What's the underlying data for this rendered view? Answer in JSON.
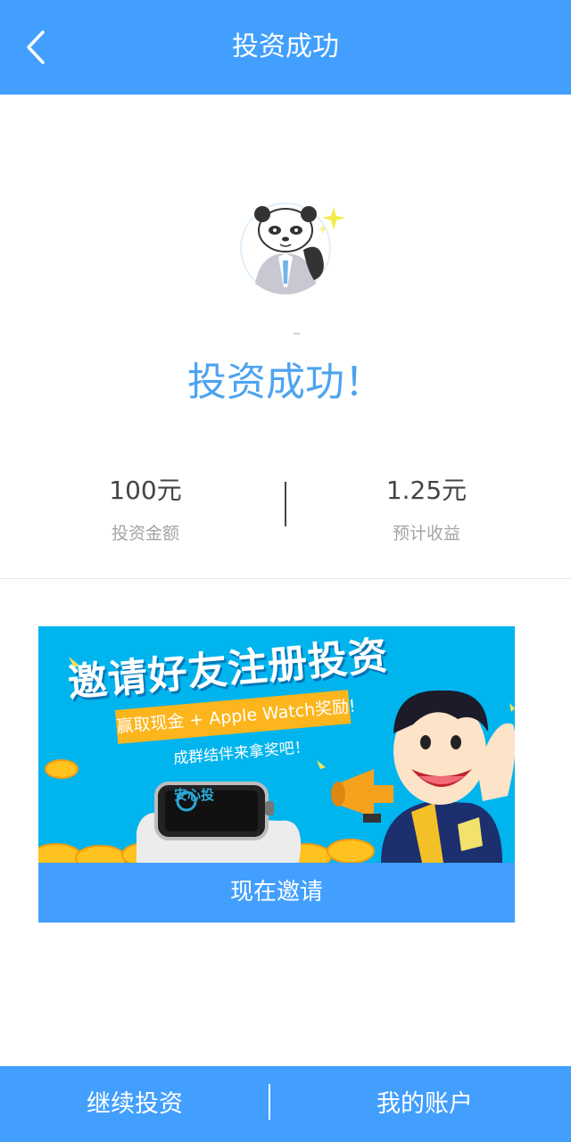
{
  "header": {
    "title": "投资成功",
    "back_icon": "chevron-left-icon"
  },
  "avatar": {
    "icon": "panda-avatar-icon"
  },
  "success_message": "投资成功！",
  "stats": [
    {
      "value": "100元",
      "label": "投资金额"
    },
    {
      "value": "1.25元",
      "label": "预计收益"
    }
  ],
  "banner": {
    "headline": "邀请好友注册投资",
    "ribbon": "赢取现金 + Apple Watch奖励!",
    "subline": "成群结伴来拿奖吧！",
    "watch_brand": "安心投",
    "button_label": "现在邀请"
  },
  "footer": {
    "continue_label": "继续投资",
    "account_label": "我的账户"
  },
  "colors": {
    "primary": "#429ffe",
    "success_text": "#4da3f0",
    "banner_bg": "#00b4ee",
    "ribbon": "#fcb51c"
  }
}
